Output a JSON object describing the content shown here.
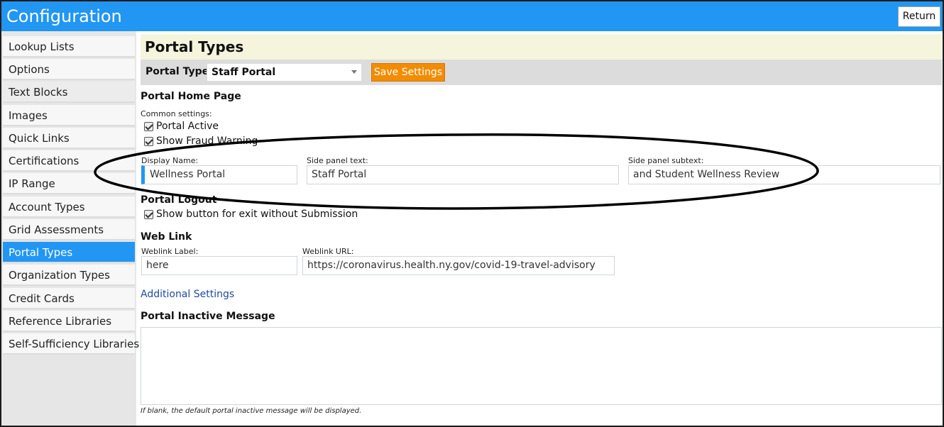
{
  "header": {
    "title": "Configuration",
    "return_label": "Return"
  },
  "sidebar": {
    "items": [
      {
        "label": "Lookup Lists"
      },
      {
        "label": "Options"
      },
      {
        "label": "Text Blocks"
      },
      {
        "label": "Images"
      },
      {
        "label": "Quick Links"
      },
      {
        "label": "Certifications"
      },
      {
        "label": "IP Range"
      },
      {
        "label": "Account Types"
      },
      {
        "label": "Grid Assessments"
      },
      {
        "label": "Portal Types"
      },
      {
        "label": "Organization Types"
      },
      {
        "label": "Credit Cards"
      },
      {
        "label": "Reference Libraries"
      },
      {
        "label": "Self-Sufficiency Libraries"
      }
    ],
    "active": "Portal Types"
  },
  "main": {
    "title": "Portal Types",
    "toolbar": {
      "portal_type_label": "Portal Type:",
      "portal_type_value": "Staff Portal",
      "save_label": "Save Settings"
    },
    "home_page": {
      "heading": "Portal Home Page",
      "common_label": "Common settings:",
      "portal_active_label": "Portal Active",
      "portal_active_checked": true,
      "fraud_warning_label": "Show Fraud Warning",
      "fraud_warning_checked": true,
      "display_name_label": "Display Name:",
      "display_name_value": "Wellness Portal",
      "side_panel_text_label": "Side panel text:",
      "side_panel_text_value": "Staff Portal",
      "side_panel_subtext_label": "Side panel subtext:",
      "side_panel_subtext_value": "and Student Wellness Review"
    },
    "logout": {
      "heading": "Portal Logout",
      "exit_button_label": "Show button for exit without Submission",
      "exit_button_checked": true
    },
    "web_link": {
      "heading": "Web Link",
      "label_label": "Weblink Label:",
      "label_value": "here",
      "url_label": "Weblink URL:",
      "url_value": "https://coronavirus.health.ny.gov/covid-19-travel-advisory"
    },
    "additional_settings_link": "Additional Settings",
    "inactive": {
      "heading": "Portal Inactive Message",
      "value": "",
      "hint": "If blank, the default portal inactive message will be displayed."
    }
  },
  "colors": {
    "header_blue": "#2196f3",
    "save_orange": "#f28c00",
    "title_bar": "#f5f4dc",
    "annotation": "#000000"
  },
  "annotation": {
    "shape": "hand-drawn ellipse",
    "highlights": "display name and side panel fields"
  }
}
